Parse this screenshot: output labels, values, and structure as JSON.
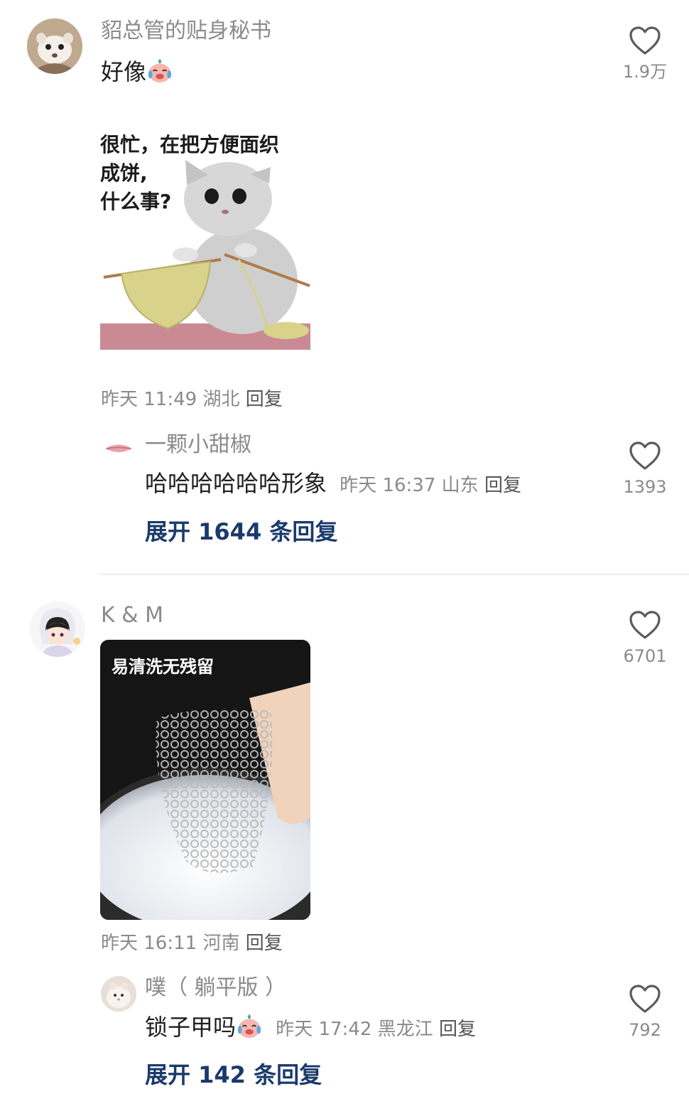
{
  "comments": [
    {
      "username": "貂总管的贴身秘书",
      "text": "好像",
      "emoji": "crying-laughing-face-icon",
      "image": {
        "caption_lines": [
          "很忙，在把方便面织",
          "成饼,",
          "什么事?"
        ]
      },
      "meta": {
        "time": "昨天 11:49",
        "location": "湖北",
        "reply": "回复"
      },
      "likes": "1.9万",
      "reply": {
        "username": "一颗小甜椒",
        "text": "哈哈哈哈哈哈形象",
        "meta": {
          "time": "昨天 16:37",
          "location": "山东",
          "reply": "回复"
        },
        "likes": "1393"
      },
      "expand": "展开 1644 条回复"
    },
    {
      "username": "K & M",
      "image": {
        "caption": "易清洗无残留"
      },
      "meta": {
        "time": "昨天 16:11",
        "location": "河南",
        "reply": "回复"
      },
      "likes": "6701",
      "reply": {
        "username": "噗（ 躺平版 ）",
        "text": "锁子甲吗",
        "emoji": "crying-laughing-face-icon",
        "meta": {
          "time": "昨天 17:42",
          "location": "黑龙江",
          "reply": "回复"
        },
        "likes": "792"
      },
      "expand": "展开 142 条回复"
    }
  ]
}
